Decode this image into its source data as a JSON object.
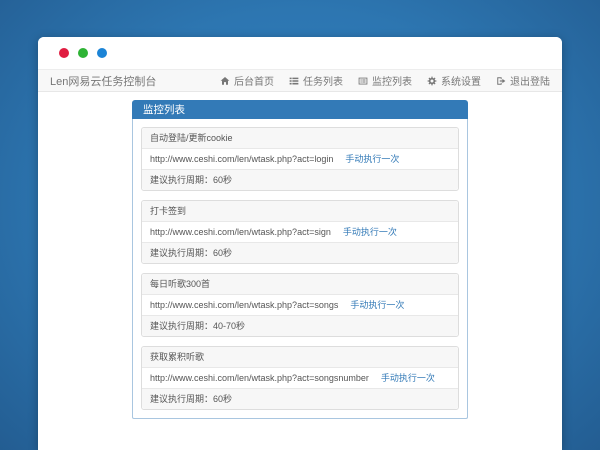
{
  "window": {
    "traffic_lights": [
      {
        "name": "red",
        "color": "#e01d41"
      },
      {
        "name": "green",
        "color": "#2eb335"
      },
      {
        "name": "blue",
        "color": "#1c84d6"
      }
    ]
  },
  "navbar": {
    "brand": "Len网易云任务控制台",
    "menu": [
      {
        "icon": "home-icon",
        "label": "后台首页"
      },
      {
        "icon": "task-list-icon",
        "label": "任务列表"
      },
      {
        "icon": "monitor-list-icon",
        "label": "监控列表"
      },
      {
        "icon": "settings-gear-icon",
        "label": "系统设置"
      },
      {
        "icon": "logout-icon",
        "label": "退出登陆"
      }
    ]
  },
  "panel": {
    "title": "监控列表",
    "tasks": [
      {
        "name": "自动登陆/更新cookie",
        "url": "http://www.ceshi.com/len/wtask.php?act=login",
        "action": "手动执行一次",
        "cycle": "建议执行周期：60秒"
      },
      {
        "name": "打卡签到",
        "url": "http://www.ceshi.com/len/wtask.php?act=sign",
        "action": "手动执行一次",
        "cycle": "建议执行周期：60秒"
      },
      {
        "name": "每日听歌300首",
        "url": "http://www.ceshi.com/len/wtask.php?act=songs",
        "action": "手动执行一次",
        "cycle": "建议执行周期：40-70秒"
      },
      {
        "name": "获取累积听歌",
        "url": "http://www.ceshi.com/len/wtask.php?act=songsnumber",
        "action": "手动执行一次",
        "cycle": "建议执行周期：60秒"
      }
    ]
  },
  "colors": {
    "page_background": "#2d76b1",
    "panel_header": "#337ab7",
    "link": "#337ab7",
    "navbar_text": "#777777"
  }
}
